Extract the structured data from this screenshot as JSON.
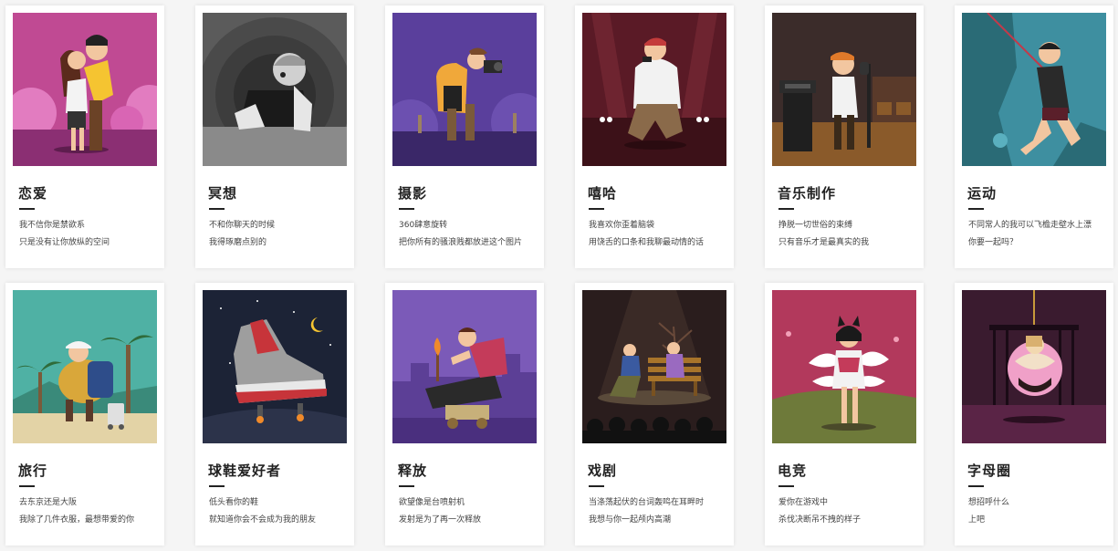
{
  "cards": [
    {
      "title": "恋爱",
      "line1": "我不信你是禁欲系",
      "line2": "只是没有让你放纵的空间",
      "icon": "couple-illustration",
      "bg": "#c04a93"
    },
    {
      "title": "冥想",
      "line1": "不和你聊天的时候",
      "line2": "我得琢磨点别的",
      "icon": "thinker-illustration",
      "bg": "#6e6e6e"
    },
    {
      "title": "摄影",
      "line1": "360肆意旋转",
      "line2": "把你所有的骚浪贱都放进这个图片",
      "icon": "photographer-illustration",
      "bg": "#5a3f9c"
    },
    {
      "title": "嘻哈",
      "line1": "我喜欢你歪着脑袋",
      "line2": "用饶舌的口条和我聊最动情的话",
      "icon": "rapper-illustration",
      "bg": "#6b1f2b"
    },
    {
      "title": "音乐制作",
      "line1": "挣脱一切世俗的束缚",
      "line2": "只有音乐才是最真实的我",
      "icon": "music-producer-illustration",
      "bg": "#3b2c2a"
    },
    {
      "title": "运动",
      "line1": "不同常人的我可以飞檐走壁水上漂",
      "line2": "你要一起吗？",
      "icon": "climber-illustration",
      "bg": "#3e8fa0"
    },
    {
      "title": "旅行",
      "line1": "去东京还是大阪",
      "line2": "我除了几件衣服，最想带爱的你",
      "icon": "traveler-illustration",
      "bg": "#4fb1a4"
    },
    {
      "title": "球鞋爱好者",
      "line1": "低头看你的鞋",
      "line2": "就知道你会不会成为我的朋友",
      "icon": "sneaker-illustration",
      "bg": "#1c2336"
    },
    {
      "title": "释放",
      "line1": "欲望像是台喷射机",
      "line2": "发射是为了再一次释放",
      "icon": "cannon-illustration",
      "bg": "#7b5ab8"
    },
    {
      "title": "戏剧",
      "line1": "当涤荡起伏的台词轰鸣在耳畔时",
      "line2": "我想与你一起颅内高潮",
      "icon": "theater-illustration",
      "bg": "#2a1d1d"
    },
    {
      "title": "电竞",
      "line1": "爱你在游戏中",
      "line2": "杀伐决断吊不拽的样子",
      "icon": "gamer-illustration",
      "bg": "#b2395c"
    },
    {
      "title": "字母圈",
      "line1": "想招呼什么",
      "line2": "上吧",
      "icon": "cage-illustration",
      "bg": "#3a1b2f"
    }
  ]
}
